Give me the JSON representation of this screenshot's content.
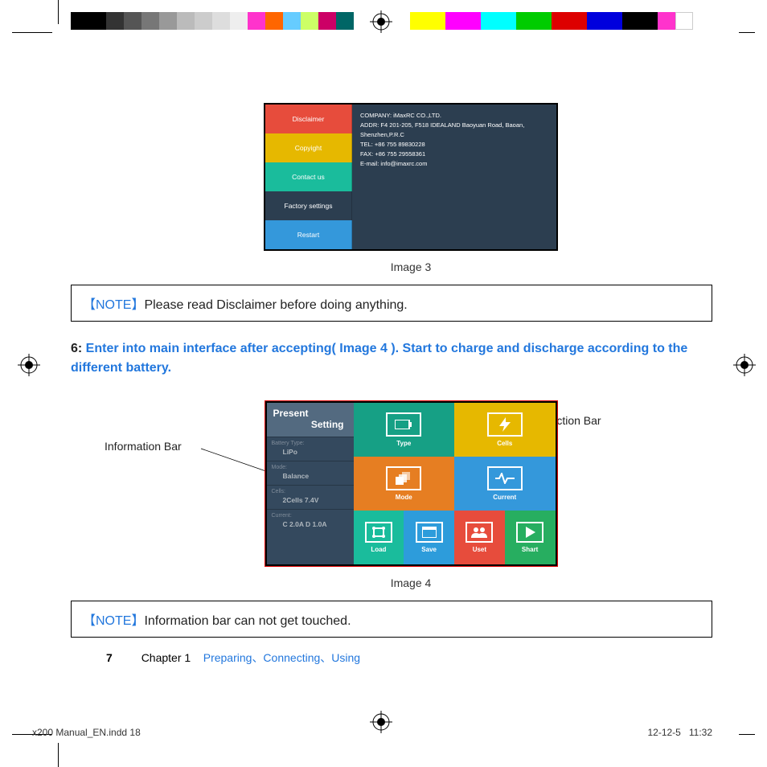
{
  "image3": {
    "buttons": [
      "Disclaimer",
      "Copyight",
      "Contact us",
      "Factory settings",
      "Restart"
    ],
    "info": {
      "company": "COMPANY: iMaxRC CO.,LTD.",
      "addr": "ADDR: F4 201-205, F518 IDEALAND Baoyuan Road, Baoan, Shenzhen,P.R.C",
      "tel": "TEL: +86 755 89830228",
      "fax": "FAX: +86 755 29558361",
      "email": "E-mail: info@imaxrc.com"
    },
    "caption": "Image 3"
  },
  "note1": {
    "tag": "【NOTE】",
    "text": "Please read Disclaimer before doing anything."
  },
  "section6": {
    "num": "6: ",
    "text": "Enter into main interface after accepting( Image 4 ). Start to charge and discharge according to the different battery."
  },
  "labels": {
    "action": "Action Bar",
    "info": "Information Bar"
  },
  "image4": {
    "present": {
      "line1": "Present",
      "line2": "Setting"
    },
    "rows": [
      {
        "lbl": "Battery Type:",
        "val": "LiPo"
      },
      {
        "lbl": "Mode:",
        "val": "Balance"
      },
      {
        "lbl": "Cells:",
        "val": "2Cells  7.4V"
      },
      {
        "lbl": "Current:",
        "val": "C 2.0A  D 1.0A"
      }
    ],
    "tiles": {
      "type": "Type",
      "cells": "Cells",
      "mode": "Mode",
      "current": "Current",
      "load": "Load",
      "save": "Save",
      "uset": "Uset",
      "shart": "Shart"
    },
    "caption": "Image 4"
  },
  "note2": {
    "tag": "【NOTE】",
    "text": "Information bar can not get touched."
  },
  "chapter": {
    "page": "7",
    "label": "Chapter 1",
    "topics": "Preparing、Connecting、Using"
  },
  "footer": {
    "file": "x200 Manual_EN.indd   18",
    "date": "12-12-5",
    "time": "11:32"
  }
}
